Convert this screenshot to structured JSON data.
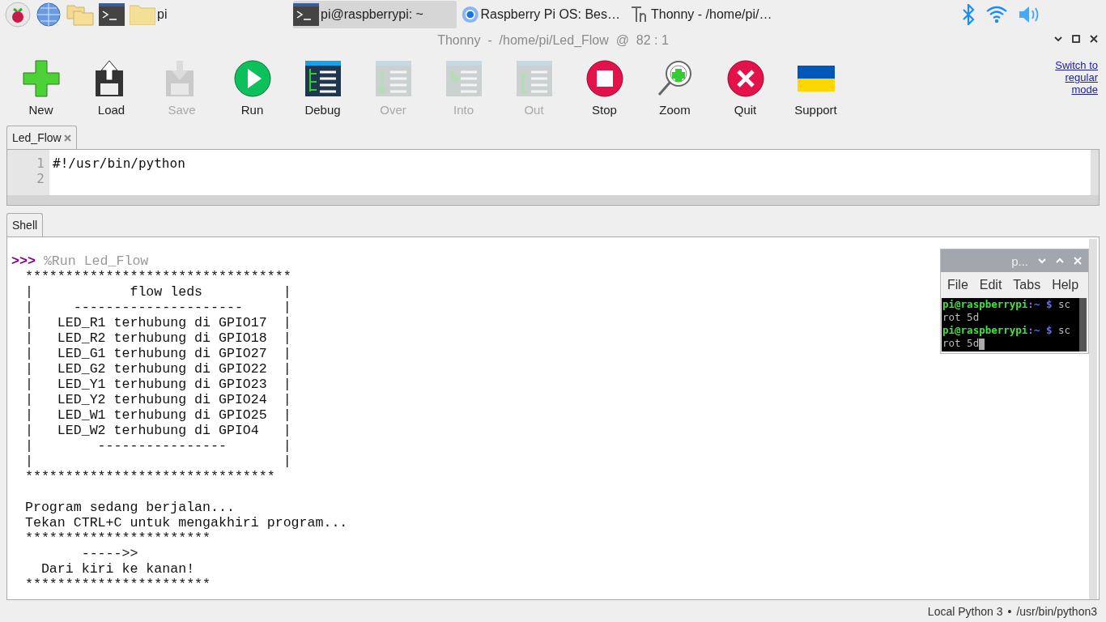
{
  "taskbar": {
    "launchers": [
      {
        "kind": "menu"
      },
      {
        "kind": "browser"
      },
      {
        "kind": "files"
      },
      {
        "kind": "terminal"
      }
    ],
    "windows": [
      {
        "kind": "folder",
        "label": "pi",
        "selected": false
      },
      {
        "kind": "terminal",
        "label": "pi@raspberrypi: ~",
        "selected": true
      },
      {
        "kind": "browser",
        "label": "Raspberry Pi OS: Bes…",
        "selected": false
      },
      {
        "kind": "thonny",
        "label": "Thonny  -  /home/pi/…",
        "selected": false
      }
    ],
    "tray": [
      {
        "kind": "bluetooth"
      },
      {
        "kind": "wifi"
      },
      {
        "kind": "volume"
      }
    ]
  },
  "window": {
    "title": "Thonny  -  /home/pi/Led_Flow  @  82 : 1"
  },
  "toolbar": [
    {
      "kind": "new",
      "label": "New",
      "disabled": false
    },
    {
      "kind": "load",
      "label": "Load",
      "disabled": false
    },
    {
      "kind": "save",
      "label": "Save",
      "disabled": true
    },
    {
      "kind": "run",
      "label": "Run",
      "disabled": false
    },
    {
      "kind": "debug",
      "label": "Debug",
      "disabled": false
    },
    {
      "kind": "over",
      "label": "Over",
      "disabled": true
    },
    {
      "kind": "into",
      "label": "Into",
      "disabled": true
    },
    {
      "kind": "out",
      "label": "Out",
      "disabled": true
    },
    {
      "kind": "stop",
      "label": "Stop",
      "disabled": false
    },
    {
      "kind": "zoom",
      "label": "Zoom",
      "disabled": false
    },
    {
      "kind": "quit",
      "label": "Quit",
      "disabled": false
    },
    {
      "kind": "support",
      "label": "Support",
      "disabled": false
    }
  ],
  "mode_link": "Switch to regular mode",
  "editor": {
    "tabs": [
      {
        "label": "Led_Flow",
        "selected": true
      }
    ],
    "lines": [
      {
        "number": "1",
        "code": "#!/usr/bin/python"
      },
      {
        "number": "2"
      }
    ]
  },
  "shell": {
    "tab": "Shell",
    "prompt": ">>>",
    "command": "%Run Led_Flow",
    "output": [
      [
        "*********************************",
        "|            flow leds          |",
        "|     ---------------------     |",
        "|   LED_R1 terhubung di GPIO17  |",
        "|   LED_R2 terhubung di GPIO18  |",
        "|   LED_G1 terhubung di GPIO27  |",
        "|   LED_G2 terhubung di GPIO22  |",
        "|   LED_Y1 terhubung di GPIO23  |",
        "|   LED_Y2 terhubung di GPIO24  |",
        "|   LED_W1 terhubung di GPIO25  |",
        "|   LED_W2 terhubung di GPIO4   |",
        "|        ----------------       |",
        "|                               |",
        "*******************************"
      ],
      [
        "Program sedang berjalan...",
        "Tekan CTRL+C untuk mengakhiri program...",
        "***********************",
        "       ----->>",
        "  Dari kiri ke kanan!",
        "***********************"
      ]
    ]
  },
  "terminal": {
    "title": "p...",
    "menus": [
      "File",
      "Edit",
      "Tabs",
      "Help"
    ],
    "lines": [
      {
        "kind": "prompt",
        "user": "pi@raspberrypi",
        "path": ":~",
        "symbol": "$",
        "command": "sc"
      },
      {
        "kind": "output",
        "text": "rot 5d"
      },
      {
        "kind": "prompt",
        "user": "pi@raspberrypi",
        "path": ":~",
        "symbol": "$",
        "command": "sc"
      },
      {
        "kind": "output",
        "text": "rot 5d"
      }
    ]
  },
  "status_bar": {
    "interpreter": "Local Python 3",
    "separator": "•",
    "path": "/usr/bin/python3"
  }
}
